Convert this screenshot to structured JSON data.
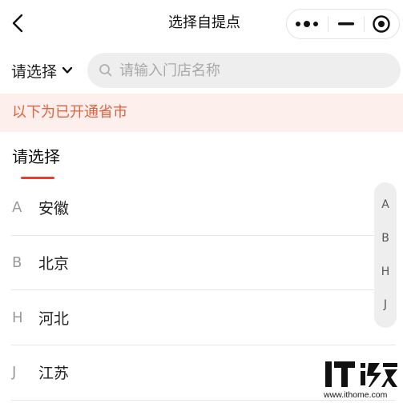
{
  "navbar": {
    "title": "选择自提点"
  },
  "filter": {
    "region_label": "请选择",
    "search_placeholder": "请输入门店名称",
    "search_value": ""
  },
  "notice": {
    "text": "以下为已开通省市"
  },
  "tab": {
    "label": "请选择"
  },
  "list": {
    "items": [
      {
        "letter": "A",
        "name": "安徽"
      },
      {
        "letter": "B",
        "name": "北京"
      },
      {
        "letter": "H",
        "name": "河北"
      },
      {
        "letter": "J",
        "name": "江苏"
      }
    ]
  },
  "index_bar": {
    "letters": [
      "A",
      "B",
      "H",
      "J"
    ]
  },
  "watermark": {
    "logo_text": "IT之家",
    "url": "www.ithome.com"
  },
  "colors": {
    "accent": "#e83e2f",
    "notice_bg": "#fdefec",
    "notice_text": "#e0623f",
    "search_bg": "#eeeeee"
  }
}
